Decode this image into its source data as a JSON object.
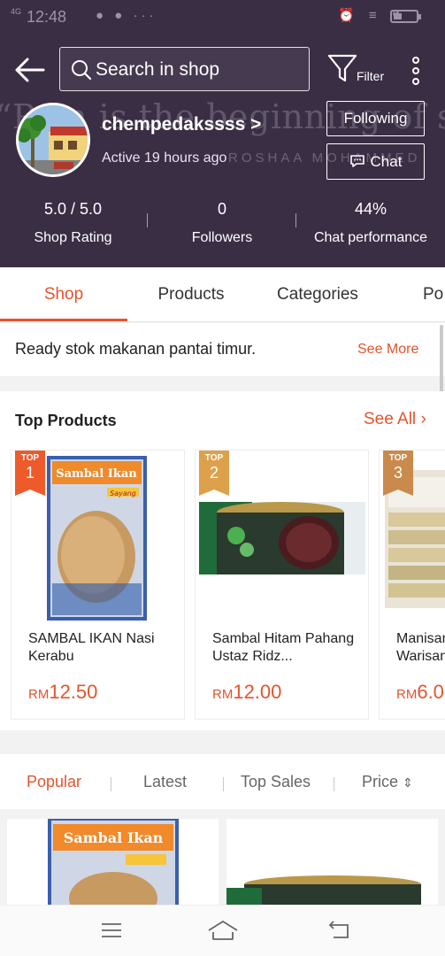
{
  "status_bar": {
    "time": "12:48",
    "signal": "4G",
    "notifications": "● ● ···",
    "right_icons": "⏰ ≡ ↯"
  },
  "header": {
    "background_quote": "“Pain is the beginning of success.”",
    "background_quote_author": "ROSHAA MOHAMMED",
    "search_placeholder": "Search in shop",
    "filter_label": "Filter",
    "shop_name": "chempedakssss >",
    "active_status": "Active 19 hours ago",
    "following_label": "Following",
    "chat_label": "Chat",
    "stats": [
      {
        "value": "5.0 / 5.0",
        "label": "Shop Rating"
      },
      {
        "value": "0",
        "label": "Followers"
      },
      {
        "value": "44%",
        "label": "Chat performance"
      }
    ],
    "bg_color": "#3a2e45"
  },
  "tabs": [
    {
      "label": "Shop",
      "active": true
    },
    {
      "label": "Products",
      "active": false
    },
    {
      "label": "Categories",
      "active": false
    },
    {
      "label": "Po",
      "active": false
    }
  ],
  "description": {
    "text": "Ready stok makanan pantai timur.",
    "see_more": "See More"
  },
  "top_products": {
    "title": "Top Products",
    "see_all": "See All",
    "items": [
      {
        "badge_top": "TOP",
        "rank": "1",
        "name": "SAMBAL IKAN Nasi Kerabu",
        "currency": "RM",
        "price": "12.50"
      },
      {
        "badge_top": "TOP",
        "rank": "2",
        "name": "Sambal Hitam Pahang Ustaz Ridz...",
        "currency": "RM",
        "price": "12.00"
      },
      {
        "badge_top": "TOP",
        "rank": "3",
        "name": "Manisan Warisan",
        "currency": "RM",
        "price": "6.0"
      }
    ]
  },
  "sort_bar": {
    "options": [
      {
        "label": "Popular",
        "active": true
      },
      {
        "label": "Latest",
        "active": false
      },
      {
        "label": "Top Sales",
        "active": false
      },
      {
        "label": "Price",
        "active": false
      }
    ]
  },
  "product_image_text": {
    "sambal_ikan": "Sambal Ikan",
    "sambal_brand": "Sayang"
  },
  "colors": {
    "accent": "#e5532d",
    "header": "#3a2e45"
  }
}
